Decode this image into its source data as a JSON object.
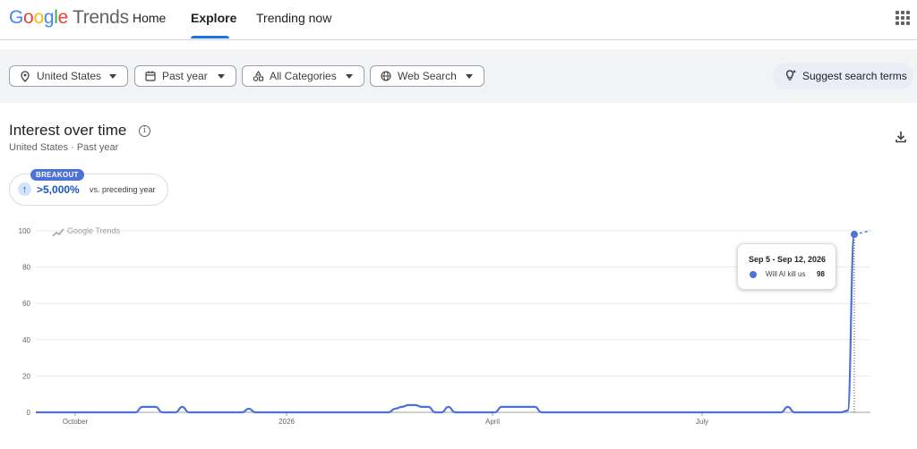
{
  "header": {
    "logo_google": "Google",
    "logo_trends": "Trends",
    "nav": [
      "Home",
      "Explore",
      "Trending now"
    ],
    "active_nav": "Explore"
  },
  "filters": {
    "location": "United States",
    "time": "Past year",
    "category": "All Categories",
    "search_type": "Web Search",
    "suggest": "Suggest search terms"
  },
  "section": {
    "title": "Interest over time",
    "subtitle": "United States · Past year"
  },
  "breakout": {
    "label": "BREAKOUT",
    "value": ">5,000%",
    "sub": "vs. preceding year"
  },
  "tooltip": {
    "date": "Sep 5 - Sep 12, 2026",
    "term": "Will AI kill us",
    "value": "98"
  },
  "colors": {
    "accent": "#1a73e8",
    "series": "#4c72d6",
    "grid": "#e8eaed"
  },
  "chart_data": {
    "type": "line",
    "watermark": "Google Trends",
    "y_ticks": [
      0,
      20,
      40,
      60,
      80,
      100
    ],
    "ylim": [
      0,
      100
    ],
    "x_tick_labels": [
      "October",
      "2026",
      "April",
      "July"
    ],
    "series": [
      {
        "name": "Will AI kill us",
        "values": [
          0,
          0,
          0,
          0,
          0,
          0,
          0,
          0,
          0,
          0,
          0,
          0,
          0,
          0,
          0,
          0,
          3,
          3,
          3,
          0,
          0,
          0,
          3,
          0,
          0,
          0,
          0,
          0,
          0,
          0,
          0,
          0,
          2,
          0,
          0,
          0,
          0,
          0,
          0,
          0,
          0,
          0,
          0,
          0,
          0,
          0,
          0,
          0,
          0,
          0,
          0,
          0,
          0,
          0,
          2,
          3,
          4,
          4,
          3,
          3,
          0,
          0,
          3,
          0,
          0,
          0,
          0,
          0,
          0,
          0,
          3,
          3,
          3,
          3,
          3,
          3,
          0,
          0,
          0,
          0,
          0,
          0,
          0,
          0,
          0,
          0,
          0,
          0,
          0,
          0,
          0,
          0,
          0,
          0,
          0,
          0,
          0,
          0,
          0,
          0,
          0,
          0,
          0,
          0,
          0,
          0,
          0,
          0,
          0,
          0,
          0,
          0,
          0,
          3,
          0,
          0,
          0,
          0,
          0,
          0,
          0,
          0,
          1,
          98
        ]
      }
    ]
  }
}
